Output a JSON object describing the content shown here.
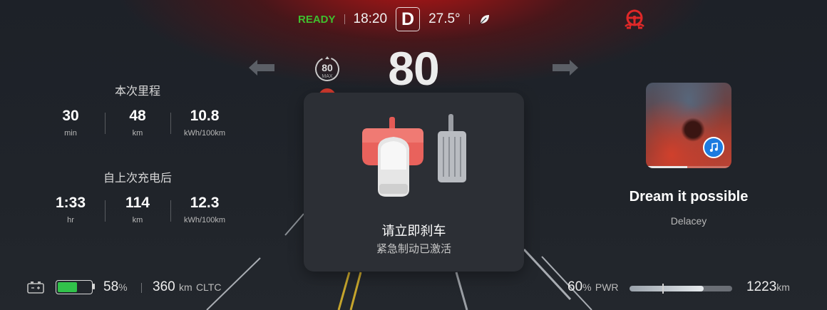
{
  "top_bar": {
    "status": "READY",
    "time": "18:20",
    "gear": "D",
    "temperature": "27.5°",
    "eco_icon": "leaf-icon",
    "alert_icon": "steering-wheel-alert-icon"
  },
  "speed": {
    "value": "80",
    "limit_value": "80",
    "limit_label": "MAX"
  },
  "trip": {
    "title": "本次里程",
    "items": [
      {
        "value": "30",
        "unit": "min"
      },
      {
        "value": "48",
        "unit": "km"
      },
      {
        "value": "10.8",
        "unit": "kWh/100km"
      }
    ]
  },
  "since_charge": {
    "title": "自上次充电后",
    "items": [
      {
        "value": "1:33",
        "unit": "hr"
      },
      {
        "value": "114",
        "unit": "km"
      },
      {
        "value": "12.3",
        "unit": "kWh/100km"
      }
    ]
  },
  "alert": {
    "title": "请立即刹车",
    "subtitle": "紧急制动已激活",
    "icon": "brake-pedal-icon"
  },
  "media": {
    "song": "Dream it possible",
    "artist": "Delacey",
    "progress": 0.48,
    "badge_icon": "music-app-icon"
  },
  "bottom": {
    "battery_percent": "58",
    "battery_level": 0.58,
    "percent_symbol": "%",
    "range_value": "360",
    "range_unit": "km",
    "range_standard": "CLTC",
    "power_percent": "60",
    "power_label": "PWR",
    "power_level": 0.72,
    "odometer_value": "1223",
    "odometer_unit": "km"
  },
  "colors": {
    "ready": "#3fbf2f",
    "alert_red": "#e04a45",
    "battery_green": "#31c24a"
  }
}
